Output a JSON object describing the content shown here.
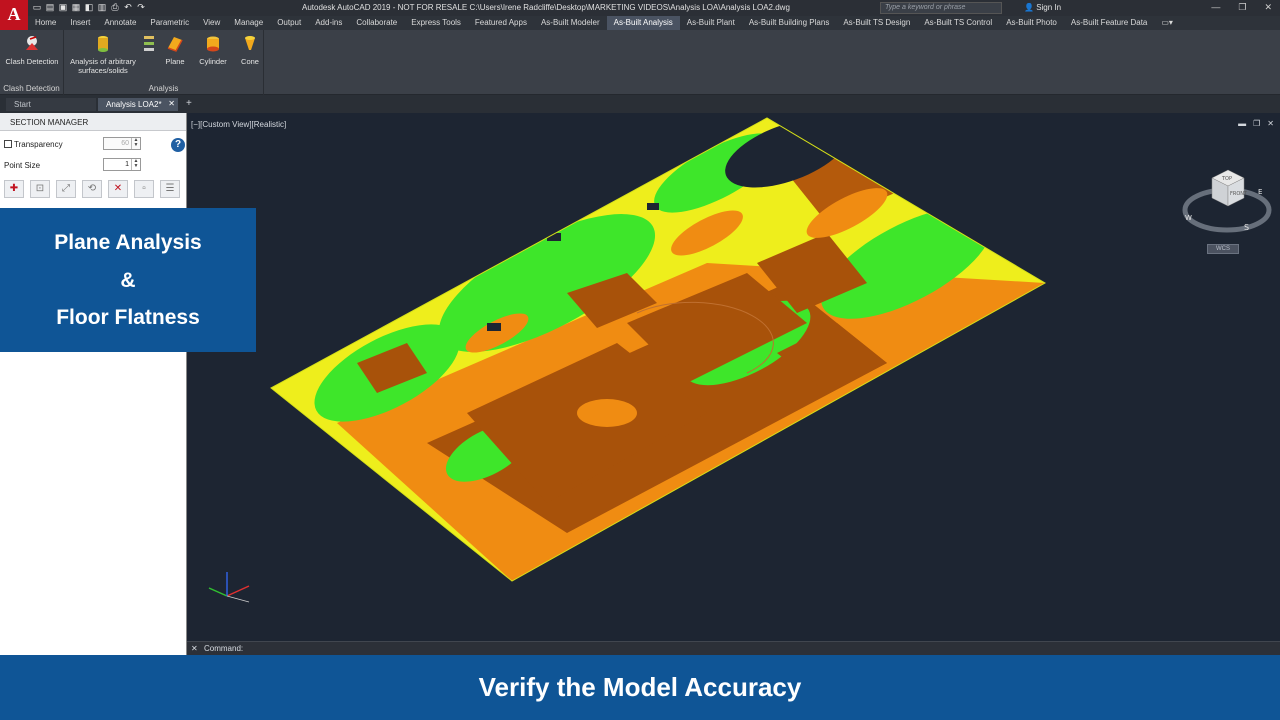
{
  "title_bar": {
    "title": "Autodesk AutoCAD 2019 - NOT FOR RESALE   C:\\Users\\Irene Radcliffe\\Desktop\\MARKETING VIDEOS\\Analysis LOA\\Analysis LOA2.dwg",
    "search_placeholder": "Type a keyword or phrase",
    "sign_in": "Sign In"
  },
  "ribbon_tabs": [
    "Home",
    "Insert",
    "Annotate",
    "Parametric",
    "View",
    "Manage",
    "Output",
    "Add-ins",
    "Collaborate",
    "Express Tools",
    "Featured Apps",
    "As-Built Modeler",
    "As-Built Analysis",
    "As-Built Plant",
    "As-Built Building Plans",
    "As-Built TS Design",
    "As-Built TS Control",
    "As-Built Photo",
    "As-Built Feature Data"
  ],
  "active_tab": "As-Built Analysis",
  "ribbon": {
    "clash_group": {
      "button": "Clash Detection",
      "title": "Clash Detection"
    },
    "analysis_group": {
      "title": "Analysis",
      "arbitrary": "Analysis of arbitrary surfaces/solids",
      "plane": "Plane",
      "cylinder": "Cylinder",
      "cone": "Cone"
    }
  },
  "doc_tabs": {
    "start": "Start",
    "active": "Analysis LOA2*"
  },
  "section_manager": {
    "title": "SECTION MANAGER",
    "transparency_label": "Transparency",
    "transparency_value": "60",
    "point_size_label": "Point Size",
    "point_size_value": "1",
    "help": "?"
  },
  "overlay": {
    "line1": "Plane Analysis",
    "line2": "&",
    "line3": "Floor Flatness"
  },
  "viewport": {
    "label": "[−][Custom View][Realistic]",
    "viewcube": {
      "top": "TOP",
      "front": "FRONT",
      "e": "E",
      "s": "S",
      "w": "W"
    },
    "wcs": "WCS"
  },
  "command": {
    "label": "Command:"
  },
  "caption": "Verify the Model Accuracy",
  "colors": {
    "accent_blue": "#0f5596",
    "active_tab": "#4a5362",
    "logo_red": "#c1121f",
    "cloud_green": "#3ee62a",
    "cloud_yellow": "#f2f21a",
    "cloud_brown": "#a8520a",
    "cloud_orange": "#f08c12"
  }
}
